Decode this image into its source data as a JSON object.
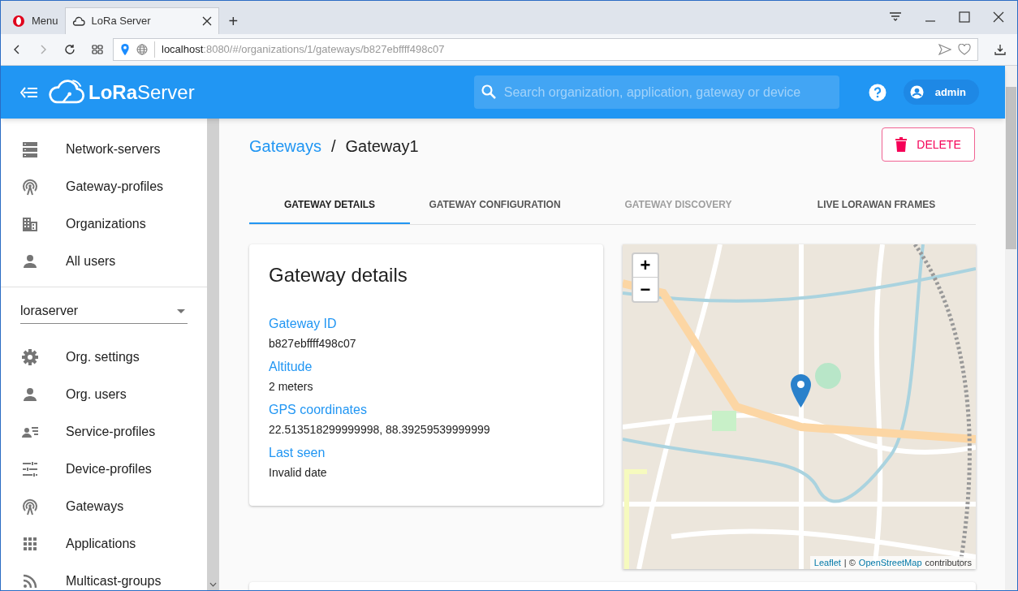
{
  "browser": {
    "tabs": [
      {
        "kind": "menu",
        "label": "Menu",
        "selected": false
      },
      {
        "kind": "page",
        "label": "LoRa Server",
        "selected": true
      }
    ],
    "new_tab": "+",
    "address": {
      "host": "localhost",
      "path": ":8080/#/organizations/1/gateways/b827ebffff498c07"
    }
  },
  "app_bar": {
    "brand_bold": "LoRa",
    "brand_light": "Server",
    "search_placeholder": "Search organization, application, gateway or device",
    "user": "admin"
  },
  "sidebar": {
    "admin_items": [
      {
        "kind": "servers",
        "label": "Network-servers"
      },
      {
        "kind": "antenna",
        "label": "Gateway-profiles"
      },
      {
        "kind": "building",
        "label": "Organizations"
      },
      {
        "kind": "person",
        "label": "All users"
      }
    ],
    "organization": "loraserver",
    "org_items": [
      {
        "kind": "gear",
        "label": "Org. settings"
      },
      {
        "kind": "person",
        "label": "Org. users"
      },
      {
        "kind": "card",
        "label": "Service-profiles"
      },
      {
        "kind": "sliders",
        "label": "Device-profiles"
      },
      {
        "kind": "antenna",
        "label": "Gateways"
      },
      {
        "kind": "grid",
        "label": "Applications"
      },
      {
        "kind": "rss",
        "label": "Multicast-groups"
      }
    ]
  },
  "breadcrumb": {
    "parent": "Gateways",
    "separator": "/",
    "current": "Gateway1"
  },
  "delete_button": "DELETE",
  "tabs": [
    {
      "label": "GATEWAY DETAILS",
      "selected": true,
      "disabled": false
    },
    {
      "label": "GATEWAY CONFIGURATION",
      "selected": false,
      "disabled": false
    },
    {
      "label": "GATEWAY DISCOVERY",
      "selected": false,
      "disabled": true
    },
    {
      "label": "LIVE LORAWAN FRAMES",
      "selected": false,
      "disabled": false
    }
  ],
  "details": {
    "title": "Gateway details",
    "fields": [
      {
        "label": "Gateway ID",
        "value": "b827ebffff498c07"
      },
      {
        "label": "Altitude",
        "value": "2 meters"
      },
      {
        "label": "GPS coordinates",
        "value": "22.513518299999998, 88.39259539999999"
      },
      {
        "label": "Last seen",
        "value": "Invalid date"
      }
    ]
  },
  "map": {
    "zoom_in": "+",
    "zoom_out": "−",
    "attribution": {
      "library": "Leaflet",
      "separator": "| ©",
      "source": "OpenStreetMap",
      "suffix": "contributors"
    }
  }
}
